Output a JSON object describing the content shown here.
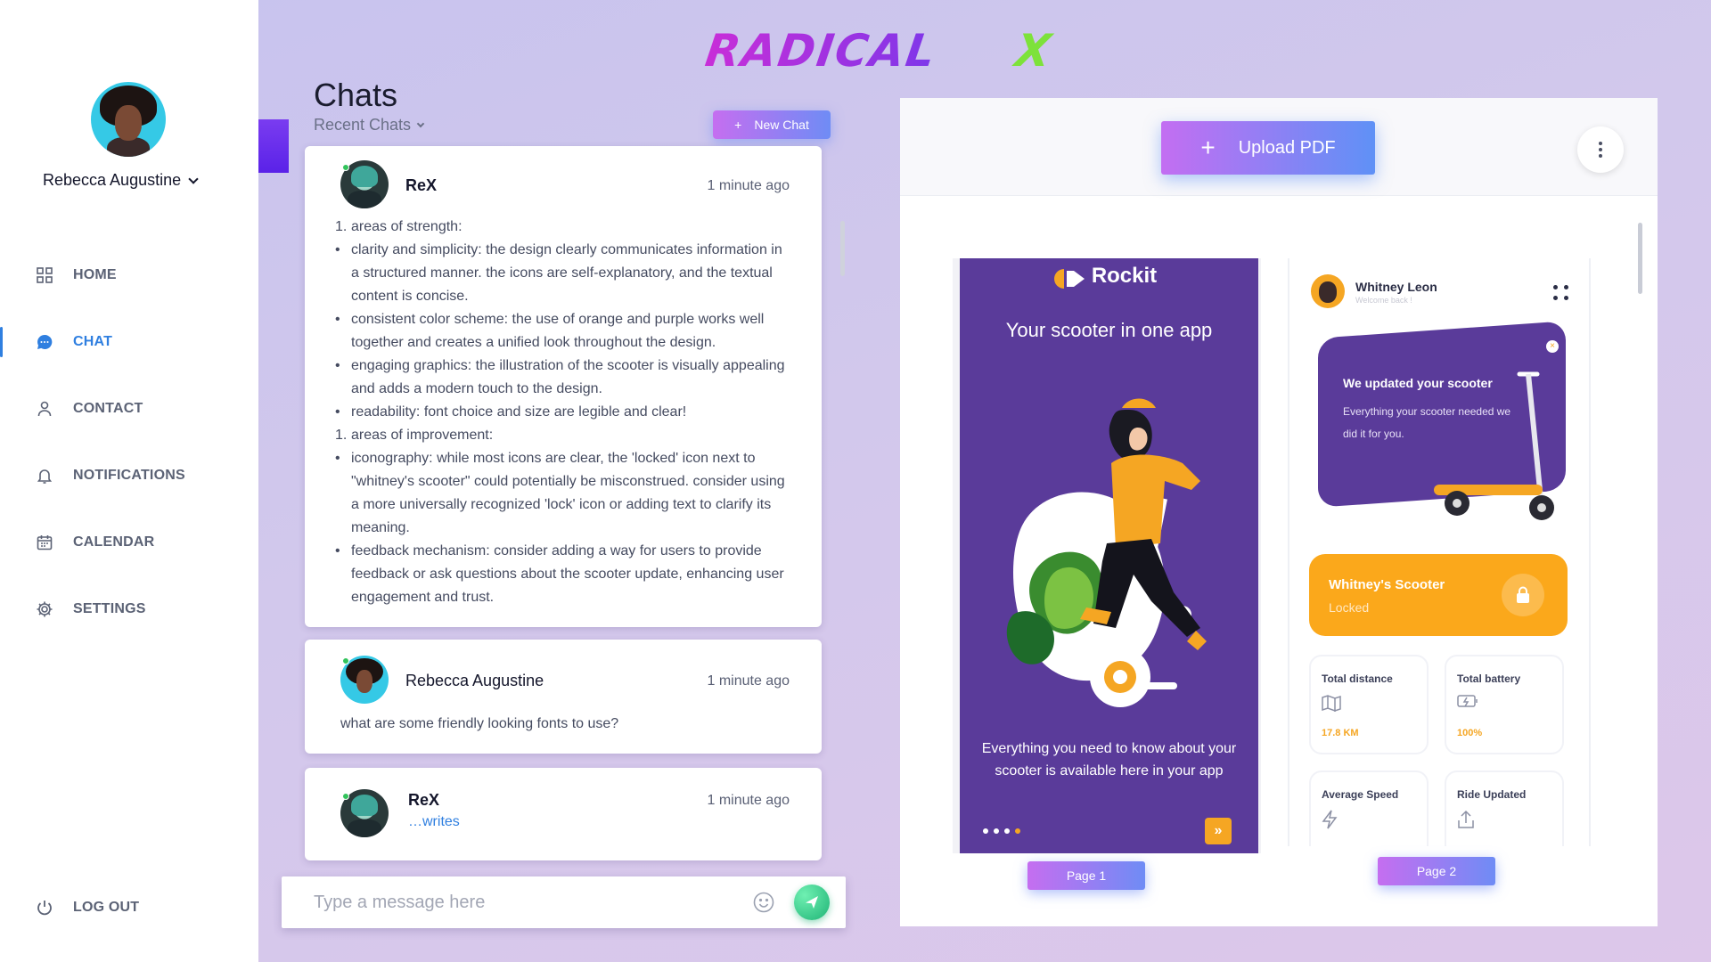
{
  "logo": {
    "text": "RADICAL",
    "x_letter": "X"
  },
  "sidebar": {
    "user_name": "Rebecca Augustine",
    "items": [
      {
        "label": "HOME",
        "icon": "grid-icon"
      },
      {
        "label": "CHAT",
        "icon": "chat-bubble-icon",
        "active": true
      },
      {
        "label": "CONTACT",
        "icon": "person-icon"
      },
      {
        "label": "NOTIFICATIONS",
        "icon": "bell-icon"
      },
      {
        "label": "CALENDAR",
        "icon": "calendar-icon"
      },
      {
        "label": "SETTINGS",
        "icon": "gear-icon"
      }
    ],
    "logout_label": "LOG OUT"
  },
  "chats": {
    "title": "Chats",
    "filter": "Recent Chats",
    "new_chat_label": "New Chat",
    "messages": [
      {
        "sender": "ReX",
        "time": "1 minute ago",
        "lines": [
          {
            "marker": "1.",
            "text": "areas of strength:"
          },
          {
            "marker": "•",
            "text": "clarity and simplicity: the design clearly communicates information in a structured manner. the icons are self-explanatory, and the textual content is concise."
          },
          {
            "marker": "•",
            "text": "consistent color scheme: the use of orange and purple works well together and creates a unified look throughout the design."
          },
          {
            "marker": "•",
            "text": "engaging graphics: the illustration of the scooter is visually appealing and adds a modern touch to the design."
          },
          {
            "marker": "•",
            "text": "readability: font choice and size are legible and clear!"
          },
          {
            "marker": "1.",
            "text": "areas of improvement:"
          },
          {
            "marker": "•",
            "text": "iconography: while most icons are clear, the 'locked' icon next to \"whitney's scooter\" could potentially be misconstrued. consider using a more universally recognized 'lock' icon or adding text to clarify its meaning."
          },
          {
            "marker": "•",
            "text": "feedback mechanism: consider adding a way for users to provide feedback or ask questions about the scooter update, enhancing user engagement and trust."
          }
        ]
      },
      {
        "sender": "Rebecca Augustine",
        "time": "1 minute ago",
        "text": "what are some friendly looking fonts to use?"
      },
      {
        "sender": "ReX",
        "time": "1 minute ago",
        "status": "writes"
      }
    ],
    "composer_placeholder": "Type a message here"
  },
  "pdf": {
    "upload_label": "Upload PDF",
    "pages": [
      {
        "button": "Page 1",
        "brand": "Rockit",
        "headline": "Your scooter in one app",
        "footer": "Everything you need to know about your scooter is available here in your app"
      },
      {
        "button": "Page 2",
        "user": "Whitney Leon",
        "user_sub": "Welcome back !",
        "promo_title": "We updated your scooter",
        "promo_text": "Everything your scooter needed we did it for you.",
        "scooter_title": "Whitney's Scooter",
        "scooter_state": "Locked",
        "stats": [
          {
            "label": "Total distance",
            "value": "17.8 KM"
          },
          {
            "label": "Total battery",
            "value": "100%"
          },
          {
            "label": "Average Speed",
            "value": ""
          },
          {
            "label": "Ride Updated",
            "value": ""
          }
        ]
      }
    ]
  },
  "colors": {
    "accent": "#2f7fe0",
    "brand_orange": "#f5a623",
    "brand_purple": "#5a3b9a",
    "online": "#32c35b"
  }
}
